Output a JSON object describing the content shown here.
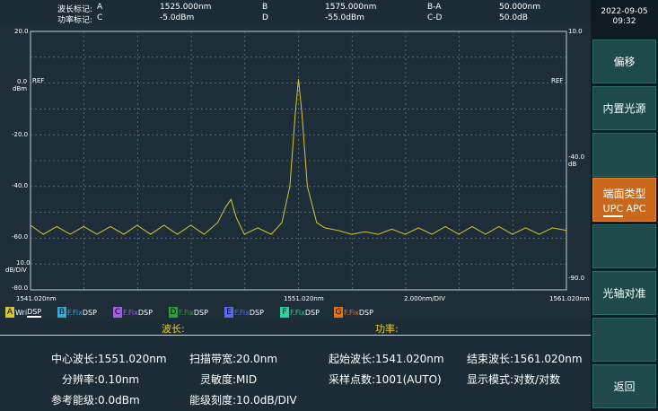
{
  "header": {
    "wavelength_marker_label": "波长标记:",
    "power_marker_label": "功率标记:",
    "markers": [
      {
        "name": "A",
        "value": "1525.000nm"
      },
      {
        "name": "B",
        "value": "1575.000nm"
      },
      {
        "name": "B-A",
        "value": "50.000nm"
      },
      {
        "name": "C",
        "value": "-5.0dBm"
      },
      {
        "name": "D",
        "value": "-55.0dBm"
      },
      {
        "name": "C-D",
        "value": "50.0dB"
      }
    ]
  },
  "plot": {
    "y_left_ticks": [
      "20.0",
      "0.0",
      "-20.0",
      "-40.0",
      "-60.0",
      "-80.0"
    ],
    "y_left_unit": "dBm",
    "ref_left": "REF",
    "scale_value": "10.0",
    "scale_unit": "dB/DIV",
    "y_right_top": "10.0",
    "ref_right": "REF",
    "y_right_mid": "-40.0",
    "y_right_mid_unit": "dB",
    "y_right_bottom": "-90.0",
    "x_start": "1541.020nm",
    "x_center": "1551.020nm",
    "x_span_per_div": "2.000nm/DIV",
    "x_end": "1561.020nm"
  },
  "chart_data": {
    "type": "line",
    "x_range": [
      1541.02,
      1561.02
    ],
    "ylim": [
      -80,
      20
    ],
    "grid": true,
    "series": [
      {
        "color": "#d8c43a",
        "x": [
          1541.02,
          1541.5,
          1542.0,
          1542.5,
          1543.0,
          1543.5,
          1544.0,
          1544.5,
          1545.0,
          1545.5,
          1546.0,
          1546.5,
          1547.0,
          1547.5,
          1548.0,
          1548.3,
          1548.5,
          1548.7,
          1549.0,
          1549.5,
          1550.0,
          1550.4,
          1550.7,
          1550.9,
          1551.02,
          1551.15,
          1551.35,
          1551.7,
          1552.0,
          1552.5,
          1553.0,
          1553.5,
          1554.0,
          1554.5,
          1555.0,
          1555.5,
          1556.0,
          1556.5,
          1557.0,
          1557.5,
          1558.0,
          1558.5,
          1559.0,
          1559.5,
          1560.0,
          1560.5,
          1561.02
        ],
        "values": [
          -55,
          -58.5,
          -55.5,
          -58.5,
          -55.5,
          -58.5,
          -55.5,
          -58.5,
          -55,
          -58.5,
          -55,
          -58.5,
          -55,
          -58.5,
          -54,
          -48,
          -45,
          -52,
          -58.5,
          -56,
          -58.5,
          -54,
          -40,
          -12,
          1.5,
          -12,
          -40,
          -54,
          -56,
          -57,
          -58.5,
          -57.5,
          -58.5,
          -56.5,
          -58.5,
          -56,
          -58.5,
          -55.5,
          -58.5,
          -55.5,
          -58.5,
          -55.5,
          -58.5,
          -56,
          -58.5,
          -56,
          -57
        ]
      }
    ]
  },
  "traces": [
    {
      "letter": "A",
      "mode": "Wri",
      "dsp": "DSP",
      "color": "#d8c43a",
      "mode_color": "#ffffff"
    },
    {
      "letter": "B",
      "mode": "F.Fix",
      "dsp": "DSP",
      "color": "#35a9d6",
      "mode_color": "#35a9d6"
    },
    {
      "letter": "C",
      "mode": "F.Fix",
      "dsp": "DSP",
      "color": "#a45ee0",
      "mode_color": "#a45ee0"
    },
    {
      "letter": "D",
      "mode": "F.Fix",
      "dsp": "DSP",
      "color": "#29a138",
      "mode_color": "#29a138"
    },
    {
      "letter": "E",
      "mode": "F.Fix",
      "dsp": "DSP",
      "color": "#5a6ae8",
      "mode_color": "#5a6ae8"
    },
    {
      "letter": "F",
      "mode": "F.Fix",
      "dsp": "DSP",
      "color": "#2fd19a",
      "mode_color": "#2fd19a"
    },
    {
      "letter": "G",
      "mode": "F.Fix",
      "dsp": "DSP",
      "color": "#e0741d",
      "mode_color": "#e0741d"
    }
  ],
  "info": {
    "wavelength_label": "波长:",
    "power_label": "功率:"
  },
  "params": {
    "center_wavelength": "中心波长:1551.020nm",
    "span": "扫描带宽:20.0nm",
    "start_wavelength": "起始波长:1541.020nm",
    "stop_wavelength": "结束波长:1561.020nm",
    "resolution": "分辨率:0.10nm",
    "sensitivity": "灵敏度:MID",
    "sampling_points": "采样点数:1001(AUTO)",
    "display_mode": "显示模式:对数/对数",
    "reference_level": "参考能级:0.0dBm",
    "level_scale": "能级刻度:10.0dB/DIV"
  },
  "side": {
    "date": "2022-09-05",
    "time": "09:32",
    "keys": {
      "offset": "偏移",
      "internal_source": "内置光源",
      "end_face_type": "端面类型",
      "end_face_value": "UPC APC",
      "axis_alignment": "光轴对准",
      "back": "返回"
    }
  }
}
